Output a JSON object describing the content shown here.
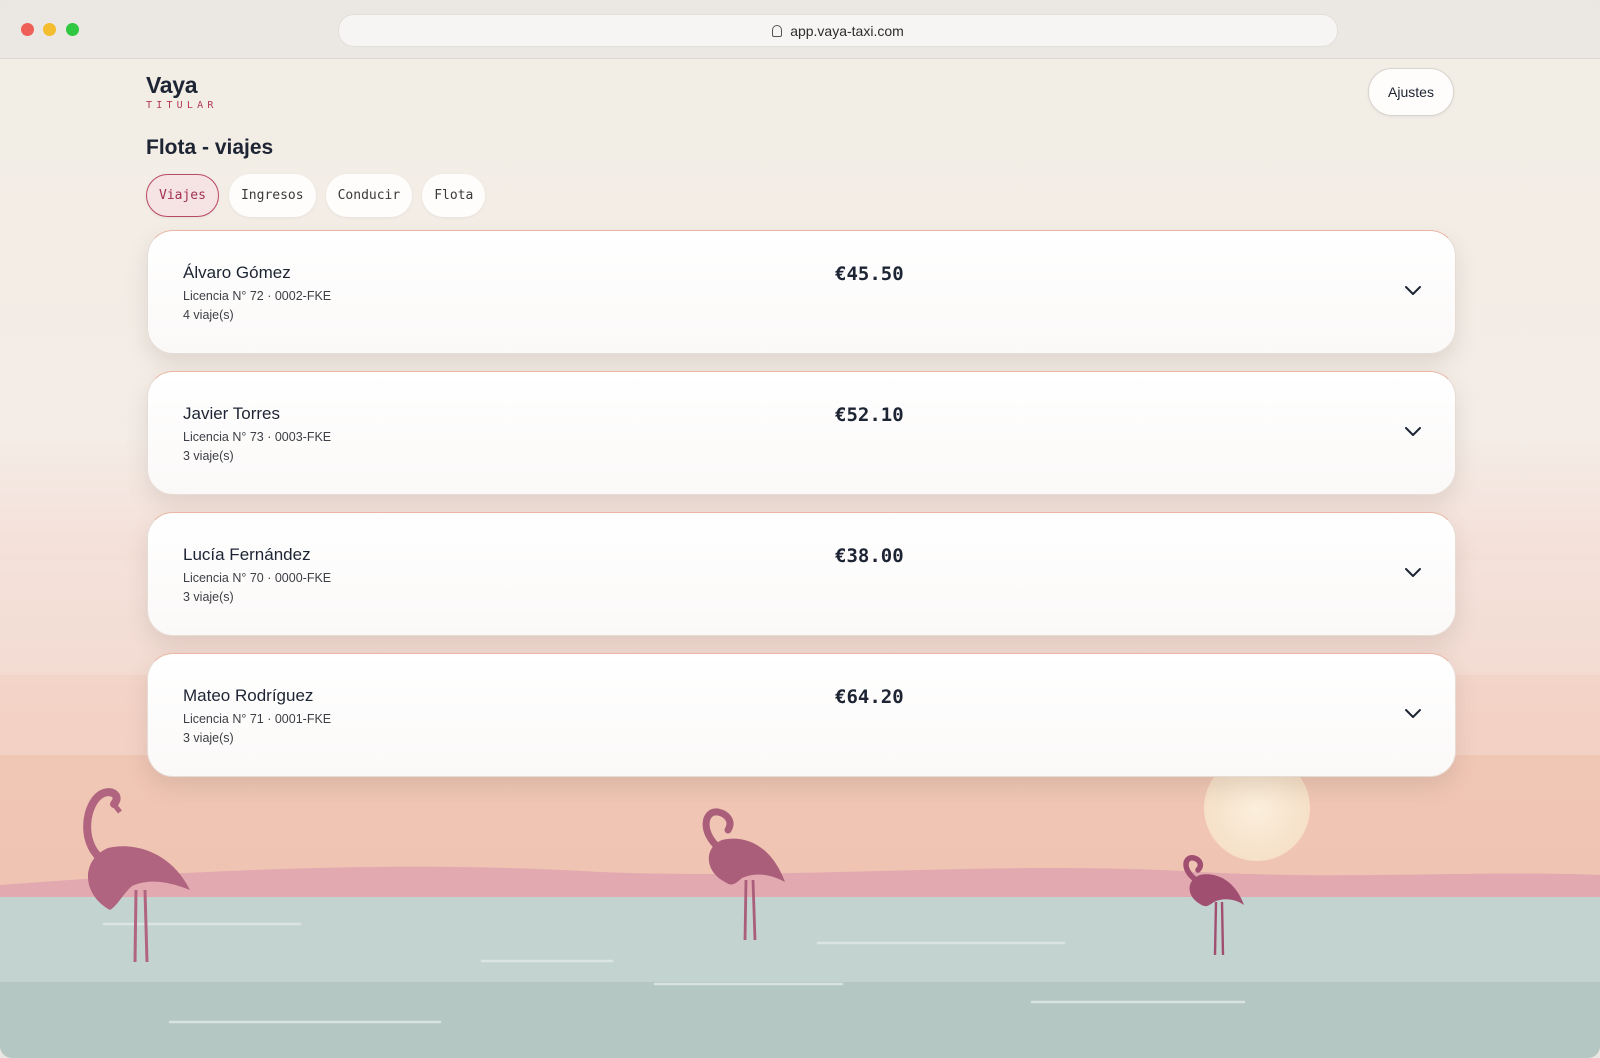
{
  "browser": {
    "url": "app.vaya-taxi.com"
  },
  "brand": {
    "name": "Vaya",
    "role": "TITULAR"
  },
  "header": {
    "settings_label": "Ajustes"
  },
  "page": {
    "title": "Flota - viajes"
  },
  "tabs": [
    {
      "label": "Viajes",
      "active": true
    },
    {
      "label": "Ingresos",
      "active": false
    },
    {
      "label": "Conducir",
      "active": false
    },
    {
      "label": "Flota",
      "active": false
    }
  ],
  "drivers": [
    {
      "name": "Álvaro Gómez",
      "license": "Licencia N° 72 · 0002-FKE",
      "trips": "4 viaje(s)",
      "amount": "€45.50"
    },
    {
      "name": "Javier Torres",
      "license": "Licencia N° 73 · 0003-FKE",
      "trips": "3 viaje(s)",
      "amount": "€52.10"
    },
    {
      "name": "Lucía Fernández",
      "license": "Licencia N° 70 · 0000-FKE",
      "trips": "3 viaje(s)",
      "amount": "€38.00"
    },
    {
      "name": "Mateo Rodríguez",
      "license": "Licencia N° 71 · 0001-FKE",
      "trips": "3 viaje(s)",
      "amount": "€64.20"
    }
  ],
  "colors": {
    "accent": "#b84a62",
    "text": "#1d2433",
    "flamingo": "#b0647f",
    "water": "#c3d3cf"
  },
  "icons": {
    "lock": "lock-icon",
    "expand": "chevron-down-icon"
  }
}
